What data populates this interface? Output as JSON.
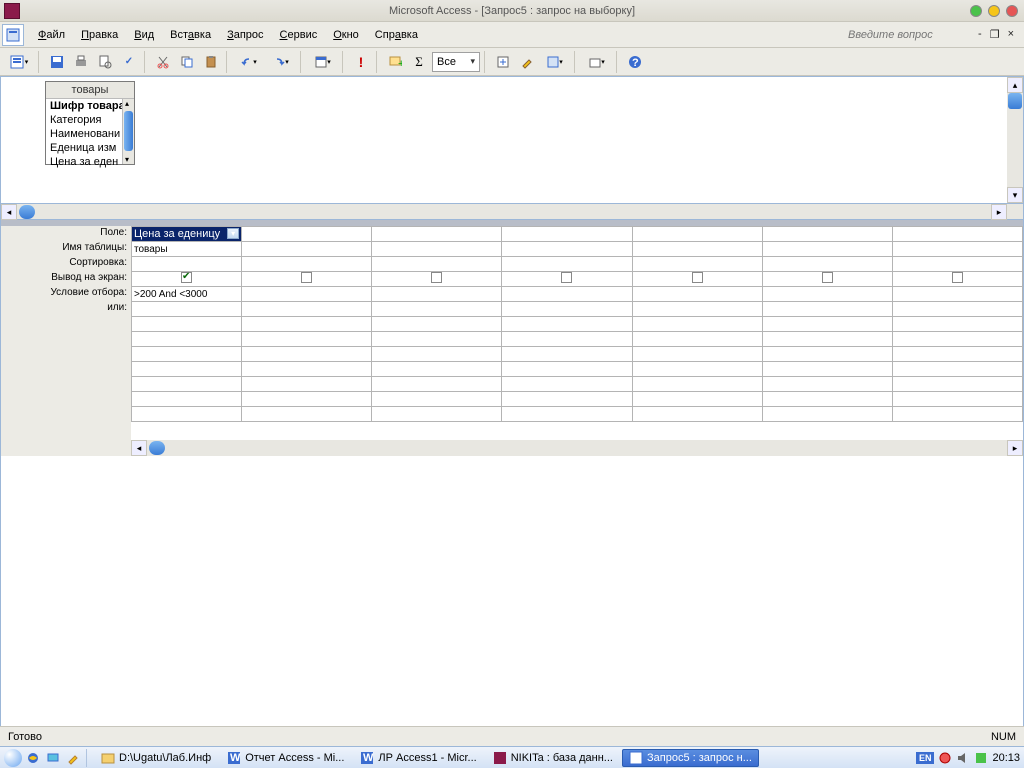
{
  "title": "Microsoft Access - [Запрос5 : запрос на выборку]",
  "menu": {
    "file": "Файл",
    "edit": "Правка",
    "view": "Вид",
    "insert": "Вставка",
    "query": "Запрос",
    "tools": "Сервис",
    "window": "Окно",
    "help": "Справка"
  },
  "help_placeholder": "Введите вопрос",
  "combo_all": "Все",
  "table": {
    "name": "товары",
    "fields": [
      "Шифр товара",
      "Категория",
      "Наименовани",
      "Еденица изм",
      "Цена за еден"
    ]
  },
  "row_labels": {
    "field": "Поле:",
    "table": "Имя таблицы:",
    "sort": "Сортировка:",
    "show": "Вывод на экран:",
    "criteria": "Условие отбора:",
    "or": "или:"
  },
  "grid": {
    "field_value": "Цена за еденицу",
    "table_value": "товары",
    "criteria_value": ">200 And <3000"
  },
  "statusbar": {
    "ready": "Готово",
    "num": "NUM"
  },
  "taskbar": {
    "path": "D:\\Ugatu\\Лаб.Инф",
    "items": [
      "Отчет Access - Mi...",
      "ЛР Access1 - Micr...",
      "NIKITa : база данн...",
      "Запрос5 : запрос н..."
    ],
    "lang": "EN",
    "time": "20:13"
  }
}
